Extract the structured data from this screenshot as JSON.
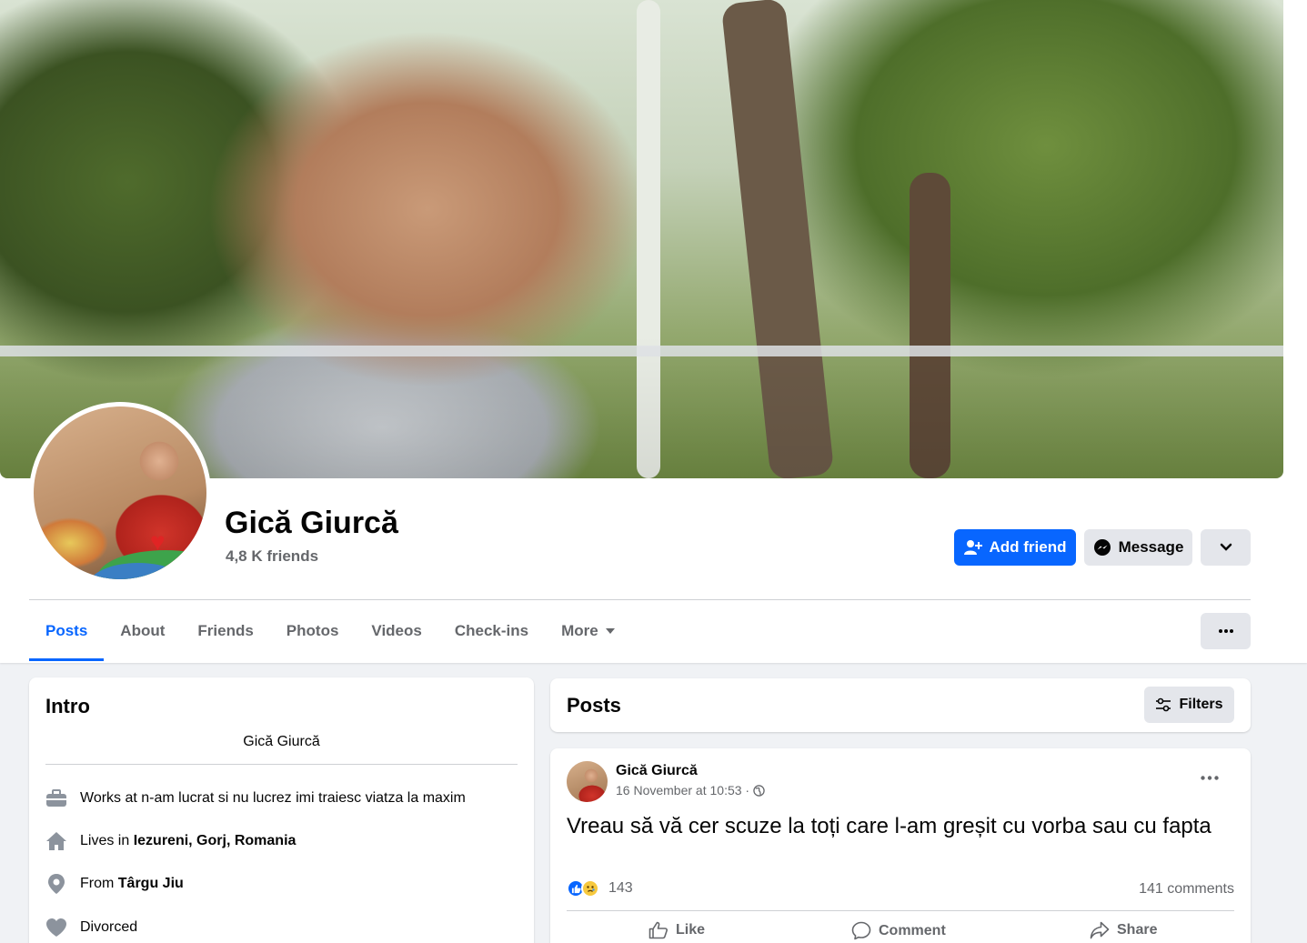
{
  "profile": {
    "name": "Gică Giurcă",
    "friends": "4,8 K friends"
  },
  "actions": {
    "add_friend": "Add friend",
    "message": "Message"
  },
  "tabs": [
    {
      "label": "Posts"
    },
    {
      "label": "About"
    },
    {
      "label": "Friends"
    },
    {
      "label": "Photos"
    },
    {
      "label": "Videos"
    },
    {
      "label": "Check-ins"
    },
    {
      "label": "More"
    }
  ],
  "intro": {
    "title": "Intro",
    "bio": "Gică Giurcă",
    "work_prefix": "Works at n-am lucrat si nu lucrez imi traiesc viatza la maxim",
    "lives_prefix": "Lives in",
    "lives_place": "Iezureni, Gorj, Romania",
    "from_prefix": "From",
    "from_place": "Târgu Jiu",
    "relationship": "Divorced"
  },
  "posts_header": {
    "title": "Posts",
    "filters": "Filters"
  },
  "post": {
    "author": "Gică Giurcă",
    "timestamp": "16 November at 10:53 ·",
    "text": "Vreau să vă cer scuze la toți care l-am greșit cu vorba sau cu fapta",
    "reactions_count": "143",
    "comments_count": "141 comments",
    "like": "Like",
    "comment": "Comment",
    "share": "Share"
  },
  "colors": {
    "accent": "#0866ff",
    "background": "#f0f2f5",
    "secondary_text": "#65676b"
  }
}
